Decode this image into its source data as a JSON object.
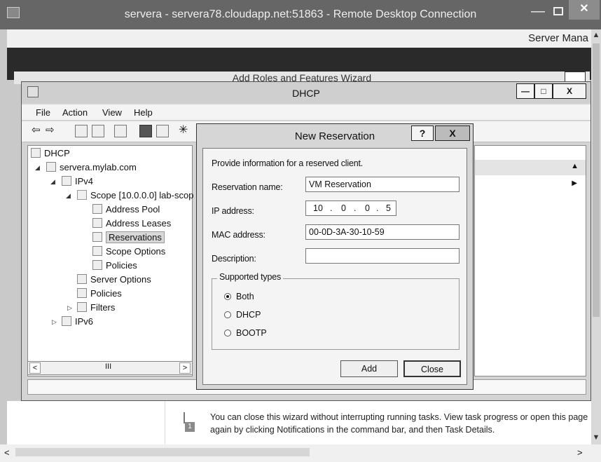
{
  "rdp": {
    "title": "servera - servera78.cloudapp.net:51863 - Remote Desktop Connection",
    "min": "—",
    "close": "✕"
  },
  "server_manager": {
    "title_fragment": "Server Mana",
    "ghost_title": "Server Manager • Dashboard"
  },
  "wizard": {
    "title": "Add Roles and Features Wizard",
    "note": "You can close this wizard without interrupting running tasks. View task progress or open this page again by clicking Notifications in the command bar, and then Task Details.",
    "badge": "1"
  },
  "dhcp": {
    "title": "DHCP",
    "menu": [
      "File",
      "Action",
      "View",
      "Help"
    ],
    "tree": {
      "root": "DHCP",
      "server": "servera.mylab.com",
      "ipv4": "IPv4",
      "scope": "Scope [10.0.0.0] lab-scop",
      "address_pool": "Address Pool",
      "address_leases": "Address Leases",
      "reservations": "Reservations",
      "scope_options": "Scope Options",
      "scope_policies": "Policies",
      "server_options": "Server Options",
      "policies": "Policies",
      "filters": "Filters",
      "ipv6": "IPv6"
    },
    "scroll_mid": "III"
  },
  "dialog": {
    "title": "New Reservation",
    "help": "?",
    "close": "X",
    "intro": "Provide information for a reserved client.",
    "name_label": "Reservation name:",
    "name_value": "VM Reservation",
    "ip_label": "IP address:",
    "ip_octets": [
      "10",
      "0",
      "0",
      "5"
    ],
    "mac_label": "MAC address:",
    "mac_value": "00-0D-3A-30-10-59",
    "desc_label": "Description:",
    "desc_value": "",
    "types_legend": "Supported types",
    "types": [
      "Both",
      "DHCP",
      "BOOTP"
    ],
    "selected_type": "Both",
    "add": "Add",
    "close_btn": "Close"
  }
}
